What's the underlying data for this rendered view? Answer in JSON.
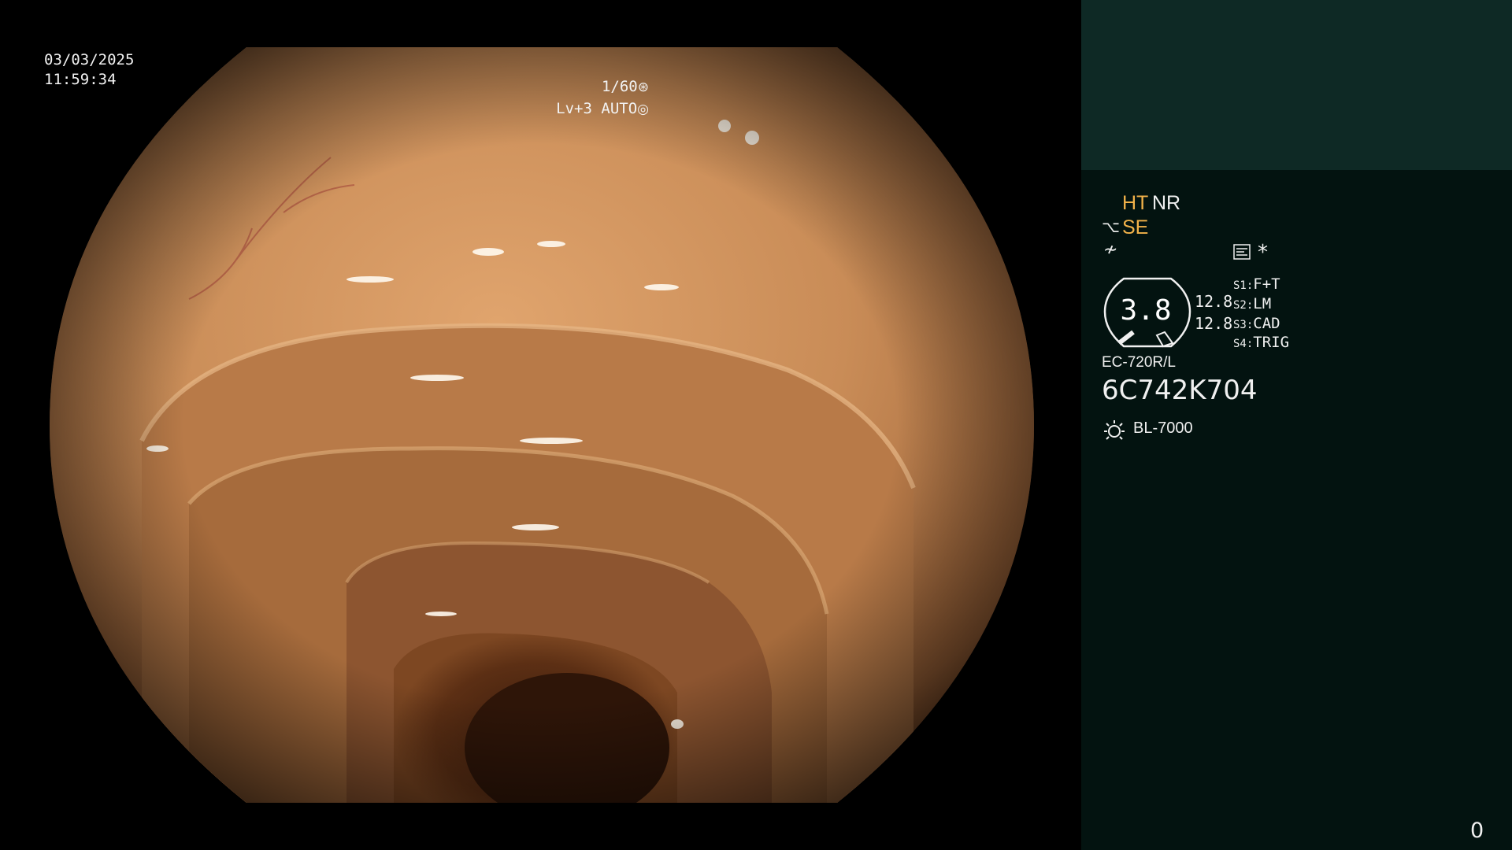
{
  "overlay": {
    "date": "03/03/2025",
    "time": "11:59:34",
    "shutter": "1/60",
    "level": "Lv+3",
    "iris_mode": "AUTO"
  },
  "panel": {
    "mode_ht": "HT",
    "mode_nr": "NR",
    "mode_se": "SE",
    "star": "*",
    "gauge_value": "3.8",
    "gauge_left": "12.8",
    "gauge_right": "12.8",
    "switches": [
      {
        "key": "S1:",
        "value": "F+T"
      },
      {
        "key": "S2:",
        "value": "LM"
      },
      {
        "key": "S3:",
        "value": "CAD"
      },
      {
        "key": "S4:",
        "value": "TRIG"
      }
    ],
    "scope_model": "EC-720R/L",
    "scope_serial": "6C742K704",
    "light_source": "BL-7000",
    "counter": "0"
  },
  "colors": {
    "panel_top": "#0e2925",
    "panel_bg": "#031310",
    "highlight": "#f2b24a"
  }
}
